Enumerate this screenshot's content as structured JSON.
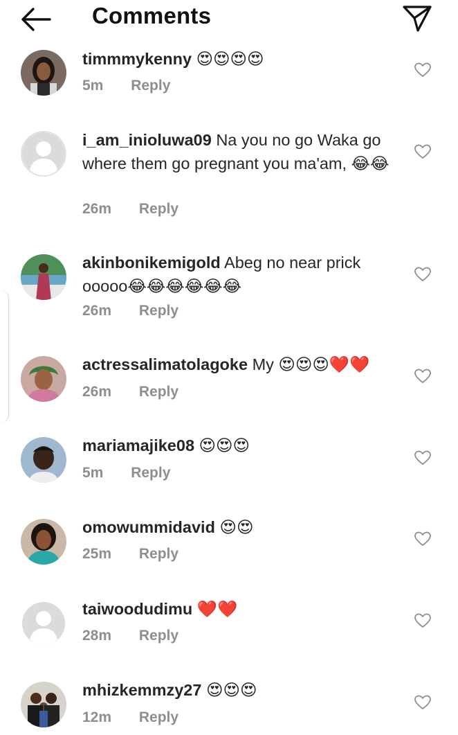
{
  "header": {
    "title": "Comments",
    "back_icon": "arrow-left-icon",
    "send_icon": "send-paper-plane-icon"
  },
  "colors": {
    "text": "#262626",
    "meta": "#8e8e8e",
    "placeholder_avatar": "#dbdbdb"
  },
  "comments": [
    {
      "user": "timmmykenny",
      "text": "😍😍😍😍",
      "time": "5m",
      "reply": "Reply",
      "avatar": "photo"
    },
    {
      "user": "i_am_inioluwa09",
      "text": "Na you no go Waka go where them go pregnant you ma'am, 😂😂",
      "time": "26m",
      "reply": "Reply",
      "avatar": "placeholder"
    },
    {
      "user": "akinbonikemigold",
      "text": "Abeg no near prick ooooo😂😂😂😂😂😂",
      "time": "26m",
      "reply": "Reply",
      "avatar": "photo"
    },
    {
      "user": "actressalimatolagoke",
      "text": "My 😍😍😍❤️❤️",
      "time": "26m",
      "reply": "Reply",
      "avatar": "photo"
    },
    {
      "user": "mariamajike08",
      "text": "😍😍😍",
      "time": "5m",
      "reply": "Reply",
      "avatar": "photo"
    },
    {
      "user": "omowummidavid",
      "text": "😍😍",
      "time": "25m",
      "reply": "Reply",
      "avatar": "photo"
    },
    {
      "user": "taiwoodudimu",
      "text": "❤️❤️",
      "time": "28m",
      "reply": "Reply",
      "avatar": "placeholder"
    },
    {
      "user": "mhizkemmzy27",
      "text": "😍😍😍",
      "time": "12m",
      "reply": "Reply",
      "avatar": "photo"
    }
  ]
}
